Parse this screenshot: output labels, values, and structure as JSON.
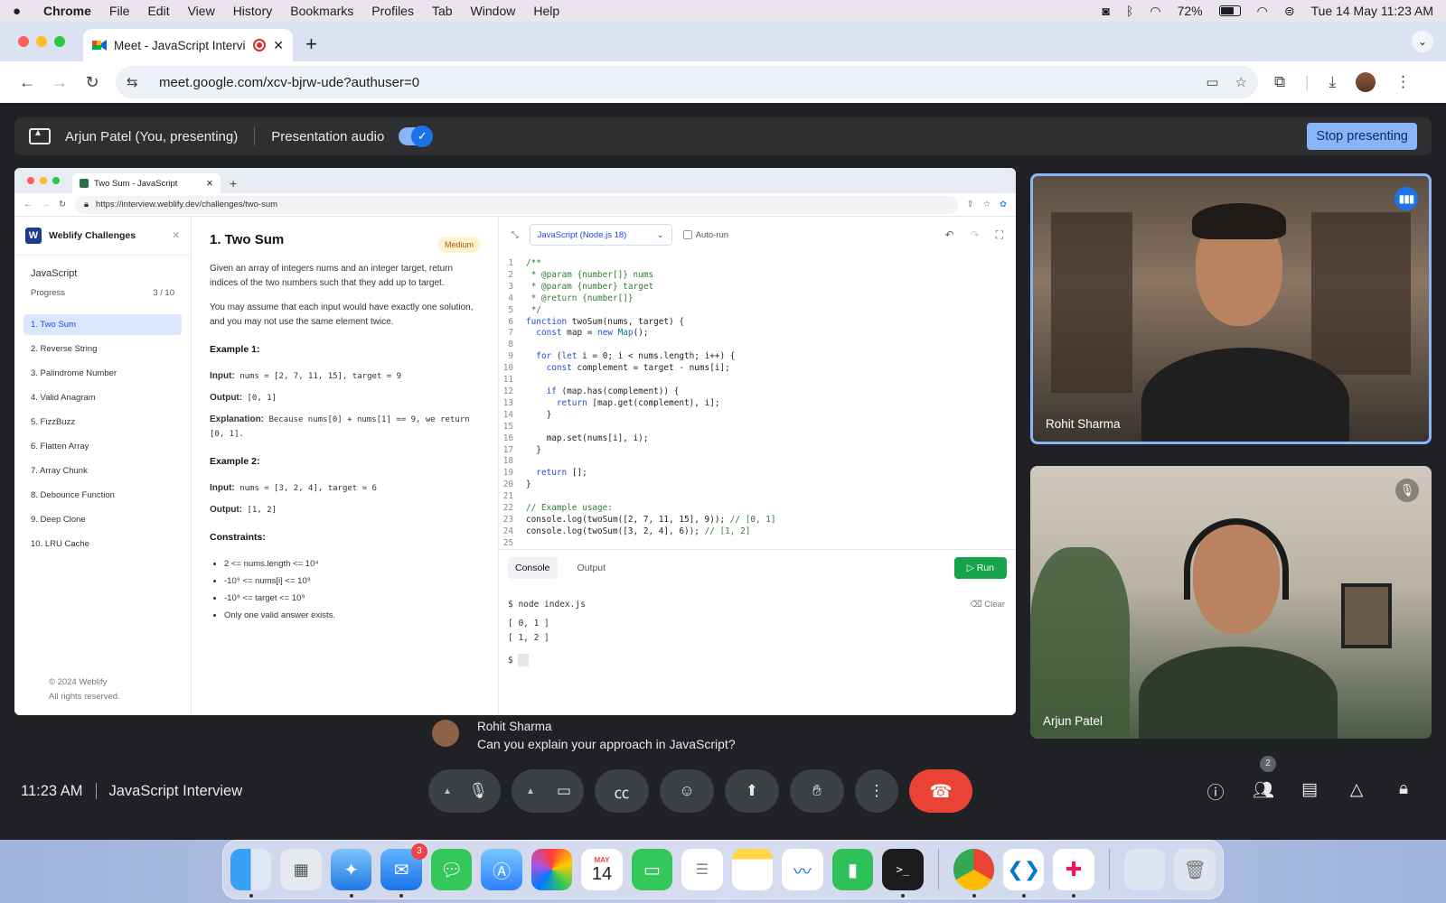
{
  "menubar": {
    "app": "Chrome",
    "items": [
      "File",
      "Edit",
      "View",
      "History",
      "Bookmarks",
      "Profiles",
      "Tab",
      "Window",
      "Help"
    ],
    "battery": "72%",
    "datetime": "Tue 14 May  11:23 AM"
  },
  "browser": {
    "tab_title": "Meet - JavaScript Interview",
    "url": "meet.google.com/xcv-bjrw-ude?authuser=0"
  },
  "presenting": {
    "who": "Arjun Patel (You, presenting)",
    "audio_label": "Presentation audio",
    "stop_label": "Stop presenting"
  },
  "shared": {
    "tab_title": "Two Sum - JavaScript",
    "url": "https://interview.weblify.dev/challenges/two-sum",
    "brand": "Weblify Challenges",
    "language": "JavaScript",
    "progress_label": "Progress",
    "progress_value": "3 / 10",
    "challenges": [
      "1. Two Sum",
      "2. Reverse String",
      "3. Palindrome Number",
      "4. Valid Anagram",
      "5. FizzBuzz",
      "6. Flatten Array",
      "7. Array Chunk",
      "8. Debounce Function",
      "9. Deep Clone",
      "10. LRU Cache"
    ],
    "copyright1": "© 2024 Weblify",
    "copyright2": "All rights reserved.",
    "problem": {
      "title": "1. Two Sum",
      "difficulty": "Medium",
      "p1": "Given an array of integers nums and an integer target, return indices of the two numbers such that they add up to target.",
      "p2": "You may assume that each input would have exactly one solution, and you may not use the same element twice.",
      "ex1_title": "Example 1:",
      "ex1_input_label": "Input:",
      "ex1_input": "nums = [2, 7, 11, 15], target = 9",
      "ex1_output_label": "Output:",
      "ex1_output": "[0, 1]",
      "ex1_expl_label": "Explanation:",
      "ex1_expl": "Because nums[0] + nums[1] == 9, we return [0, 1].",
      "ex2_title": "Example 2:",
      "ex2_input_label": "Input:",
      "ex2_input": "nums = [3, 2, 4], target = 6",
      "ex2_output_label": "Output:",
      "ex2_output": "[1, 2]",
      "constraints_title": "Constraints:",
      "constraints": [
        "2 <= nums.length <= 10⁴",
        "-10⁹ <= nums[i] <= 10⁹",
        "-10⁹ <= target <= 10⁹",
        "Only one valid answer exists."
      ]
    },
    "editor": {
      "language_select": "JavaScript (Node.js 18)",
      "autorun_label": "Auto-run",
      "lines": [
        "/**",
        " * @param {number[]} nums",
        " * @param {number} target",
        " * @return {number[]}",
        " */",
        "function twoSum(nums, target) {",
        "  const map = new Map();",
        "",
        "  for (let i = 0; i < nums.length; i++) {",
        "    const complement = target - nums[i];",
        "",
        "    if (map.has(complement)) {",
        "      return [map.get(complement), i];",
        "    }",
        "",
        "    map.set(nums[i], i);",
        "  }",
        "",
        "  return [];",
        "}",
        "",
        "// Example usage:",
        "console.log(twoSum([2, 7, 11, 15], 9)); // [0, 1]",
        "console.log(twoSum([3, 2, 4], 6)); // [1, 2]",
        ""
      ],
      "console_tab": "Console",
      "output_tab": "Output",
      "run_label": "Run",
      "clear_label": "Clear",
      "console_lines": [
        "$ node index.js",
        "[ 0, 1 ]",
        "[ 1, 2 ]"
      ],
      "prompt": "$"
    }
  },
  "participants": {
    "rohit": "Rohit Sharma",
    "arjun": "Arjun Patel"
  },
  "caption": {
    "speaker": "Rohit Sharma",
    "text": "Can you explain your approach in JavaScript?"
  },
  "controls": {
    "time": "11:23 AM",
    "meeting_name": "JavaScript Interview",
    "people_count": "2"
  },
  "dock": {
    "mail_badge": "3",
    "calendar_month": "MAY",
    "calendar_day": "14"
  },
  "colors": {
    "meet_bg": "#202124",
    "accent": "#8ab4f8",
    "end_call": "#ea4335",
    "run_green": "#16a34a"
  }
}
